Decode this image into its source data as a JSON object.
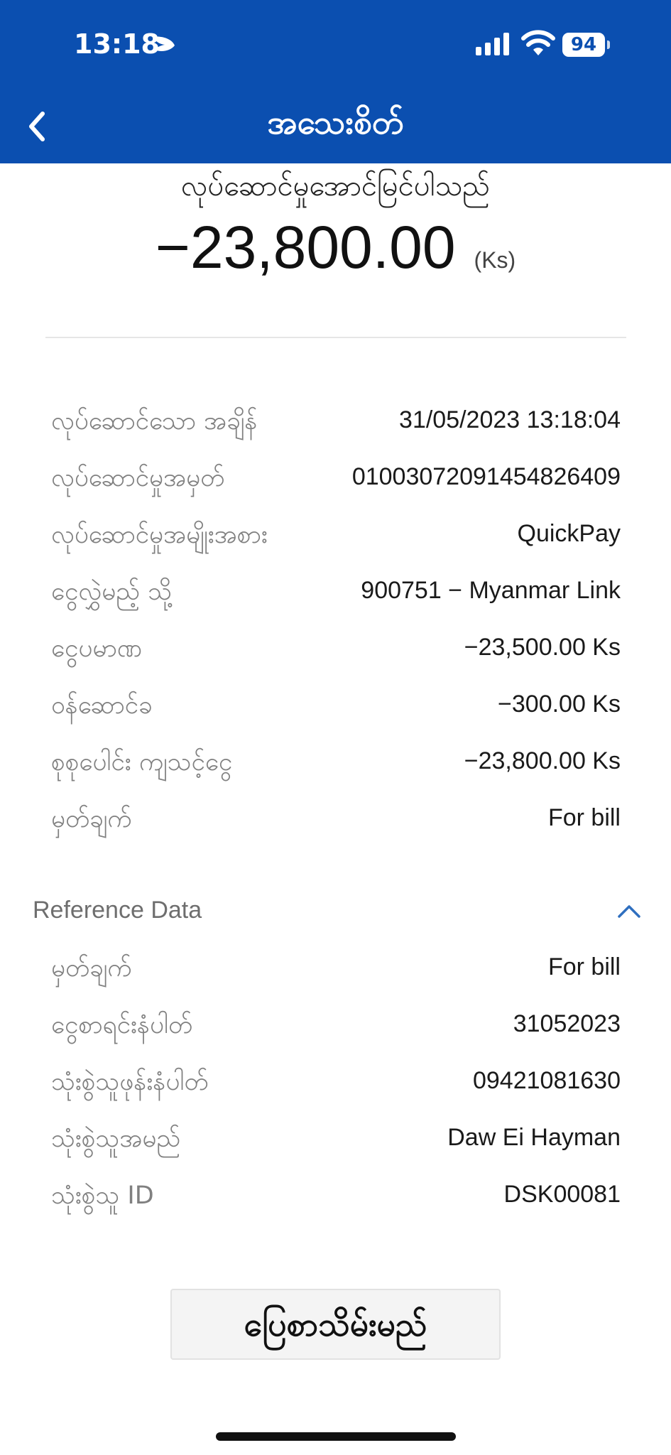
{
  "status_bar": {
    "time": "13:18",
    "battery": "94"
  },
  "header": {
    "title": "အသေးစိတ်"
  },
  "summary": {
    "status": "လုပ်ဆောင်မှုအောင်မြင်ပါသည်",
    "amount": "−23,800.00",
    "currency": "(Ks)"
  },
  "details": [
    {
      "label": "လုပ်ဆောင်သော အချိန်",
      "value": "31/05/2023 13:18:04"
    },
    {
      "label": "လုပ်ဆောင်မှုအမှတ်",
      "value": "01003072091454826409"
    },
    {
      "label": "လုပ်ဆောင်မှုအမျိုးအစား",
      "value": "QuickPay"
    },
    {
      "label": "ငွေလွှဲမည့် သို့",
      "value": "900751 − Myanmar Link"
    },
    {
      "label": "ငွေပမာဏ",
      "value": "−23,500.00 Ks"
    },
    {
      "label": "ဝန်ဆောင်ခ",
      "value": "−300.00 Ks"
    },
    {
      "label": "စုစုပေါင်း ကျသင့်ငွေ",
      "value": "−23,800.00 Ks"
    },
    {
      "label": "မှတ်ချက်",
      "value": "For bill"
    }
  ],
  "reference": {
    "title": "Reference Data",
    "items": [
      {
        "label": "မှတ်ချက်",
        "value": "For bill"
      },
      {
        "label": "ငွေစာရင်းနံပါတ်",
        "value": "31052023"
      },
      {
        "label": "သုံးစွဲသူဖုန်းနံပါတ်",
        "value": "09421081630"
      },
      {
        "label": "သုံးစွဲသူအမည်",
        "value": "Daw Ei Hayman"
      },
      {
        "label": "သုံးစွဲသူ ID",
        "value": "DSK00081"
      }
    ]
  },
  "actions": {
    "close_label": "ပြေစာသိမ်းမည်"
  },
  "colors": {
    "header_bg": "#0b4fb0",
    "label": "#808080",
    "value": "#1a1a1a",
    "accent_chevron": "#2f6fbf"
  }
}
